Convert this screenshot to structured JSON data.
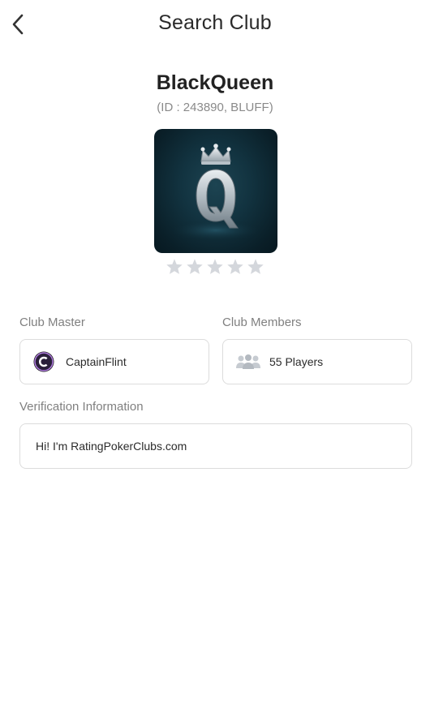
{
  "header": {
    "title": "Search Club",
    "back_icon": "chevron-left-icon"
  },
  "club": {
    "name": "BlackQueen",
    "id_line": "(ID : 243890, BLUFF)",
    "logo_icon": "queen-card-logo",
    "rating": {
      "stars_filled": 0,
      "stars_total": 5
    }
  },
  "master": {
    "label": "Club Master",
    "name": "CaptainFlint",
    "avatar_icon": "captain-avatar-icon"
  },
  "members": {
    "label": "Club Members",
    "count_text": "55 Players",
    "icon": "people-icon"
  },
  "verification": {
    "label": "Verification Information",
    "text": "Hi! I'm RatingPokerClubs.com"
  },
  "colors": {
    "star_empty": "#d4d7dc",
    "border": "#dcdcdc",
    "label": "#808080",
    "logo_bg": "#0f2d3a"
  }
}
